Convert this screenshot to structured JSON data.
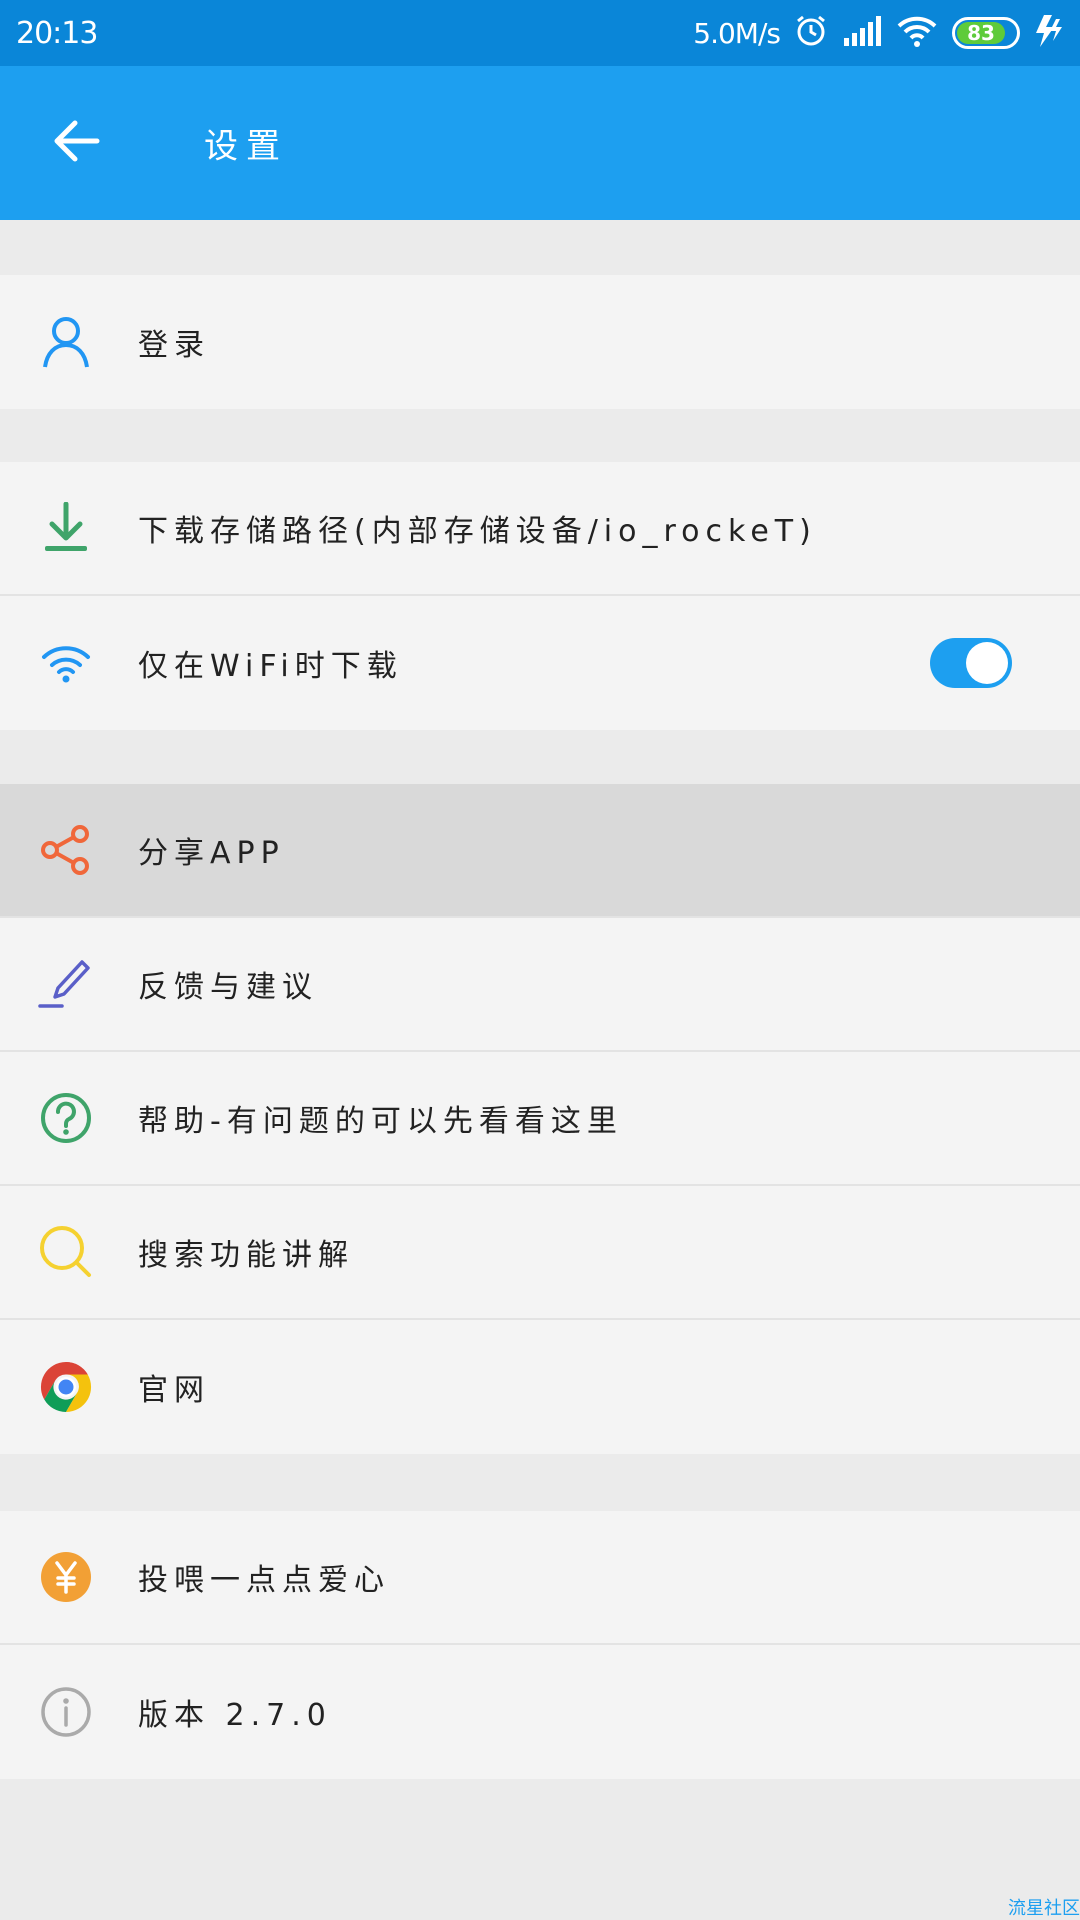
{
  "status_bar": {
    "time": "20:13",
    "net_speed": "5.0M/s",
    "battery": "83",
    "battery_level": 0.83
  },
  "app_bar": {
    "title": "设置"
  },
  "sections": [
    {
      "items": [
        {
          "label": "登录",
          "icon": "user-icon"
        }
      ]
    },
    {
      "items": [
        {
          "label": "下载存储路径(内部存储设备/io_rockeT)",
          "icon": "download-icon"
        },
        {
          "label": "仅在WiFi时下载",
          "icon": "wifi-icon",
          "toggle_on": true
        }
      ]
    },
    {
      "items": [
        {
          "label": "分享APP",
          "icon": "share-icon"
        },
        {
          "label": "反馈与建议",
          "icon": "pen-icon"
        },
        {
          "label": "帮助-有问题的可以先看看这里",
          "icon": "help-icon"
        },
        {
          "label": "搜索功能讲解",
          "icon": "search-icon"
        },
        {
          "label": "官网",
          "icon": "chrome-icon"
        }
      ]
    },
    {
      "items": [
        {
          "label": "投喂一点点爱心",
          "icon": "yen-icon"
        },
        {
          "label": "版本 2.7.0",
          "icon": "info-icon"
        }
      ]
    }
  ],
  "watermark": "流星社区",
  "colors": {
    "status_bar": "#0a86d8",
    "app_bar": "#1d9ff0",
    "toggle_on": "#1d9ff0"
  }
}
